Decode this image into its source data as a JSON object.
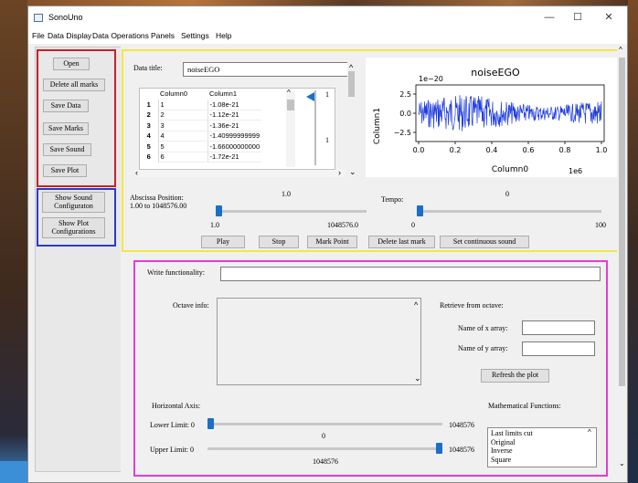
{
  "window": {
    "title": "SonoUno",
    "minimize": "—",
    "maximize": "☐",
    "close": "✕"
  },
  "menu": [
    "File",
    "Data Display",
    "Data Operations",
    "Panels",
    "Settings",
    "Help"
  ],
  "left_buttons": {
    "open": "Open",
    "delete_marks": "Delete all marks",
    "save_data": "Save Data",
    "save_marks": "Save Marks",
    "save_sound": "Save Sound",
    "save_plot": "Save Plot",
    "show_sound_1": "Show Sound",
    "show_sound_2": "Configuraton",
    "show_plot_1": "Show Plot",
    "show_plot_2": "Configurations"
  },
  "data_title": {
    "label": "Data title:",
    "value": "noiseEGO"
  },
  "table": {
    "headers": [
      "Column0",
      "Column1"
    ],
    "rows": [
      [
        "1",
        "1",
        "-1.08e-21"
      ],
      [
        "2",
        "2",
        "-1.12e-21"
      ],
      [
        "3",
        "3",
        "-1.36e-21"
      ],
      [
        "4",
        "4",
        "-1.40999999999"
      ],
      [
        "5",
        "5",
        "-1.66000000000"
      ],
      [
        "6",
        "6",
        "-1.72e-21"
      ]
    ],
    "side_slider_top": "1",
    "side_slider_mid": "1"
  },
  "plot": {
    "title": "noiseEGO",
    "offset_y": "1e−20",
    "offset_x": "1e6",
    "xlabel": "Column0",
    "ylabel": "Column1",
    "yticks": [
      "2.5",
      "0.0",
      "−2.5"
    ],
    "xticks": [
      "0.0",
      "0.2",
      "0.4",
      "0.6",
      "0.8",
      "1.0"
    ],
    "line_color": "#1f3bdc"
  },
  "abscissa": {
    "label": "Abscissa Position:",
    "range": "1.00 to 1048576.00",
    "current": "1.0",
    "min": "1.0",
    "max": "1048576.0"
  },
  "tempo": {
    "label": "Tempo:",
    "current": "0",
    "min": "0",
    "max": "100"
  },
  "controls": {
    "play": "Play",
    "stop": "Stop",
    "mark_point": "Mark Point",
    "delete_last": "Delete last mark",
    "continuous": "Set continuous sound"
  },
  "functionality": {
    "write_label": "Write functionality:",
    "octave_label": "Octave info:",
    "retrieve_label": "Retrieve from octave:",
    "x_array_label": "Name of x array:",
    "y_array_label": "Name of y array:",
    "refresh": "Refresh the plot"
  },
  "horizontal_axis": {
    "label": "Horizontal Axis:",
    "lower_label": "Lower Limit: 0",
    "lower_max": "1048576",
    "lower_current": "0",
    "upper_label": "Upper Limit: 0",
    "upper_max": "1048576",
    "upper_current": "1048576"
  },
  "math_functions": {
    "label": "Mathematical Functions:",
    "items": [
      "Last limits cut",
      "Original",
      "Inverse",
      "Square"
    ]
  }
}
